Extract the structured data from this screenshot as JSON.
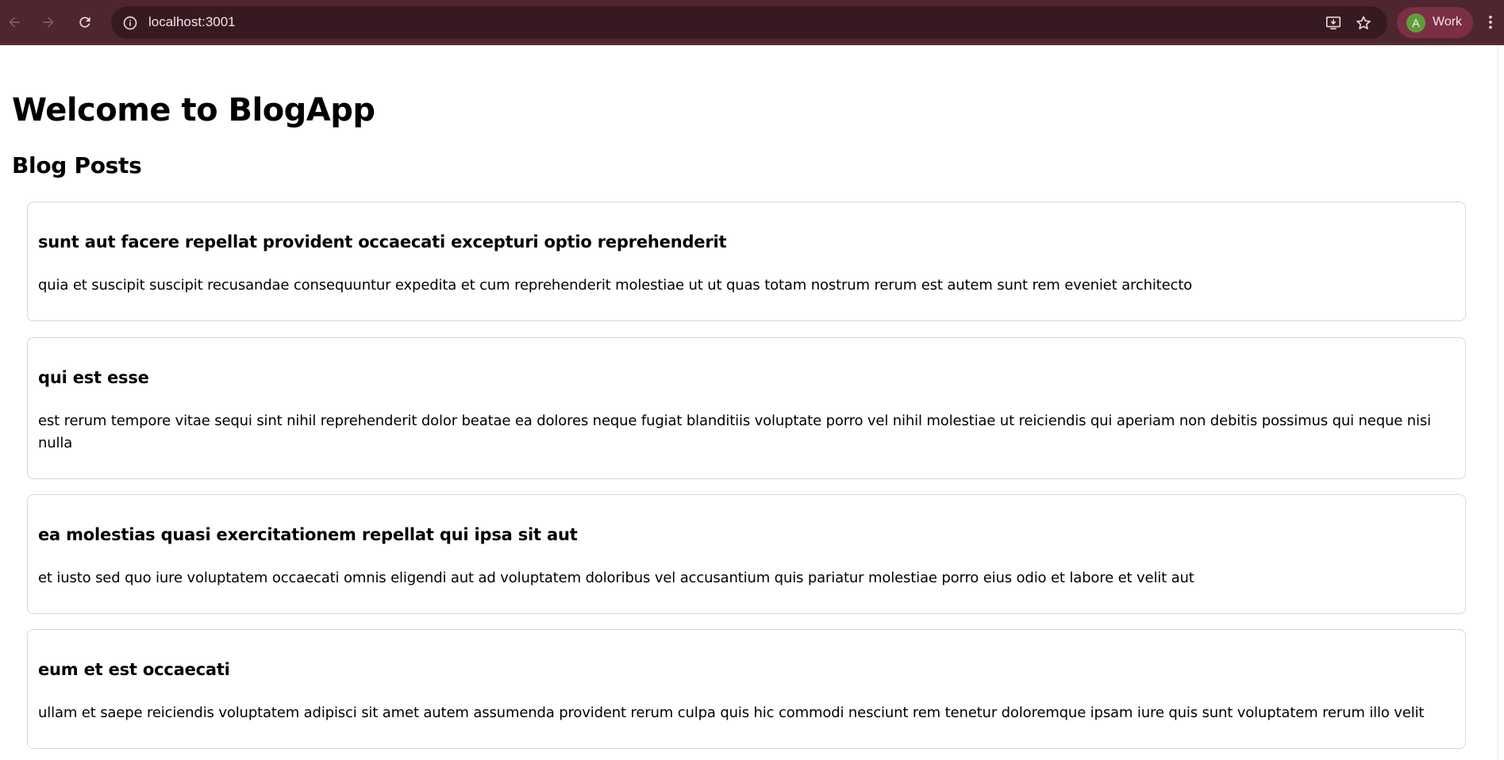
{
  "browser": {
    "url": "localhost:3001",
    "profile_initial": "A",
    "profile_name": "Work",
    "icons": [
      "back-arrow-icon",
      "forward-arrow-icon",
      "reload-icon",
      "site-info-icon",
      "install-app-icon",
      "bookmark-star-icon",
      "menu-kebab-icon"
    ],
    "colors": {
      "frame": "#4e2630",
      "omnibox": "#371a21",
      "profile": "#7a2f45",
      "avatar": "#5f9d3c"
    }
  },
  "page": {
    "title": "Welcome to BlogApp",
    "section_title": "Blog Posts",
    "posts": [
      {
        "title": "sunt aut facere repellat provident occaecati excepturi optio reprehenderit",
        "body": "quia et suscipit suscipit recusandae consequuntur expedita et cum reprehenderit molestiae ut ut quas totam nostrum rerum est autem sunt rem eveniet architecto"
      },
      {
        "title": "qui est esse",
        "body": "est rerum tempore vitae sequi sint nihil reprehenderit dolor beatae ea dolores neque fugiat blanditiis voluptate porro vel nihil molestiae ut reiciendis qui aperiam non debitis possimus qui neque nisi nulla"
      },
      {
        "title": "ea molestias quasi exercitationem repellat qui ipsa sit aut",
        "body": "et iusto sed quo iure voluptatem occaecati omnis eligendi aut ad voluptatem doloribus vel accusantium quis pariatur molestiae porro eius odio et labore et velit aut"
      },
      {
        "title": "eum et est occaecati",
        "body": "ullam et saepe reiciendis voluptatem adipisci sit amet autem assumenda provident rerum culpa quis hic commodi nesciunt rem tenetur doloremque ipsam iure quis sunt voluptatem rerum illo velit"
      }
    ]
  }
}
